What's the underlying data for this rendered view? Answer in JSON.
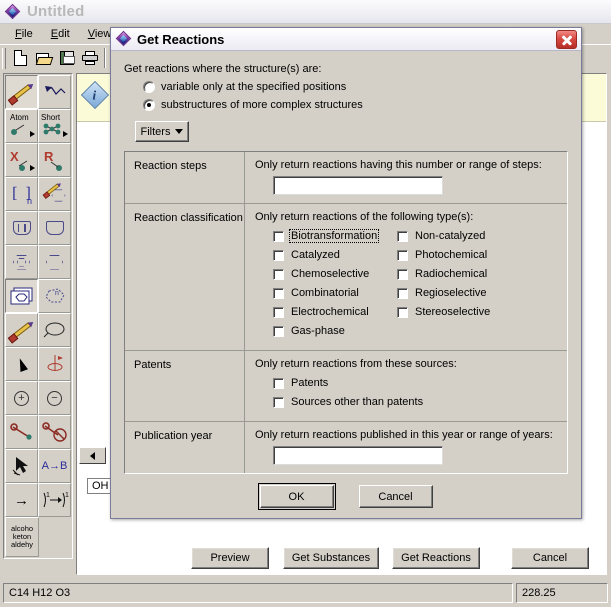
{
  "window": {
    "title": "Untitled",
    "icon": "app-diamond-icon",
    "menus": [
      "File",
      "Edit",
      "View"
    ],
    "toolbar_buttons": [
      "new-document",
      "open-folder",
      "save-disk",
      "print"
    ]
  },
  "palette": {
    "tools": [
      {
        "name": "draw-bond-pencil",
        "label": ""
      },
      {
        "name": "chain-tool",
        "label": ""
      },
      {
        "name": "atom-tool",
        "label": "Atom"
      },
      {
        "name": "shortcut-tool",
        "label": "Short"
      },
      {
        "name": "variable-atom-x-tool",
        "label": "X"
      },
      {
        "name": "r-group-tool",
        "label": "R"
      },
      {
        "name": "repeating-group-tool",
        "label": "n"
      },
      {
        "name": "edit-ring-tool",
        "label": ""
      },
      {
        "name": "cyclopentadiene-tool",
        "label": ""
      },
      {
        "name": "cyclopentane-tool",
        "label": ""
      },
      {
        "name": "benzene-tool",
        "label": ""
      },
      {
        "name": "cyclohexane-tool",
        "label": ""
      },
      {
        "name": "templates-tool",
        "label": ""
      },
      {
        "name": "heteroring-tool",
        "label": "n"
      },
      {
        "name": "bold-bond-tool",
        "label": ""
      },
      {
        "name": "lasso-select-tool",
        "label": ""
      },
      {
        "name": "pointer-select-tool",
        "label": ""
      },
      {
        "name": "rotate-tool",
        "label": ""
      },
      {
        "name": "increase-charge-tool",
        "label": "+"
      },
      {
        "name": "decrease-charge-tool",
        "label": "−"
      },
      {
        "name": "map-atoms-tool",
        "label": ""
      },
      {
        "name": "unmap-atoms-tool",
        "label": ""
      },
      {
        "name": "erase-tool",
        "label": ""
      },
      {
        "name": "atom-to-atom-map-tool",
        "label": "A→B"
      },
      {
        "name": "reaction-arrow-tool",
        "label": "→"
      },
      {
        "name": "multistep-arrow-tool",
        "label": ""
      },
      {
        "name": "functional-group-tool",
        "label": "alcohol keton aldehy"
      }
    ],
    "functional_group_lines": [
      "alcoho",
      "keton",
      "aldehy"
    ]
  },
  "canvas": {
    "oh_label": "OH",
    "info_icon": "i"
  },
  "statusbar": {
    "formula": "C14 H12 O3",
    "molecular_weight": "228.25"
  },
  "bottom_actions": [
    {
      "name": "preview-button",
      "label": "Preview"
    },
    {
      "name": "get-substances-button",
      "label": "Get Substances"
    },
    {
      "name": "get-reactions-button",
      "label": "Get Reactions"
    },
    {
      "name": "cancel-button",
      "label": "Cancel"
    }
  ],
  "dialog": {
    "title": "Get Reactions",
    "close_label": "×",
    "prompt": "Get reactions where the structure(s) are:",
    "radios": [
      {
        "label": "variable only at the specified positions",
        "selected": false
      },
      {
        "label": "substructures of more complex structures",
        "selected": true
      }
    ],
    "filters_button": "Filters",
    "sections": [
      {
        "label": "Reaction steps",
        "description": "Only return reactions having this number or range of steps:",
        "input_value": "",
        "input_placeholder": ""
      },
      {
        "label": "Reaction classification",
        "description": "Only return reactions of the following type(s):",
        "checkbox_columns": [
          [
            {
              "label": "Biotransformation",
              "checked": false,
              "focused": true
            },
            {
              "label": "Catalyzed",
              "checked": false,
              "focused": false
            },
            {
              "label": "Chemoselective",
              "checked": false,
              "focused": false
            },
            {
              "label": "Combinatorial",
              "checked": false,
              "focused": false
            },
            {
              "label": "Electrochemical",
              "checked": false,
              "focused": false
            },
            {
              "label": "Gas-phase",
              "checked": false,
              "focused": false
            }
          ],
          [
            {
              "label": "Non-catalyzed",
              "checked": false,
              "focused": false
            },
            {
              "label": "Photochemical",
              "checked": false,
              "focused": false
            },
            {
              "label": "Radiochemical",
              "checked": false,
              "focused": false
            },
            {
              "label": "Regioselective",
              "checked": false,
              "focused": false
            },
            {
              "label": "Stereoselective",
              "checked": false,
              "focused": false
            }
          ]
        ]
      },
      {
        "label": "Patents",
        "description": "Only return reactions from these sources:",
        "checkbox_columns": [
          [
            {
              "label": "Patents",
              "checked": false,
              "focused": false
            },
            {
              "label": "Sources other than patents",
              "checked": false,
              "focused": false
            }
          ]
        ]
      },
      {
        "label": "Publication year",
        "description": "Only return reactions published in this year or range of years:",
        "input_value": "",
        "input_placeholder": ""
      }
    ],
    "ok_label": "OK",
    "cancel_label": "Cancel"
  },
  "colors": {
    "face": "#d4d0c8",
    "close_red": "#d84a42",
    "hint_yellow": "#fbfbd8",
    "tool_blue": "#2a2a9a",
    "tool_red": "#b03a2e"
  }
}
